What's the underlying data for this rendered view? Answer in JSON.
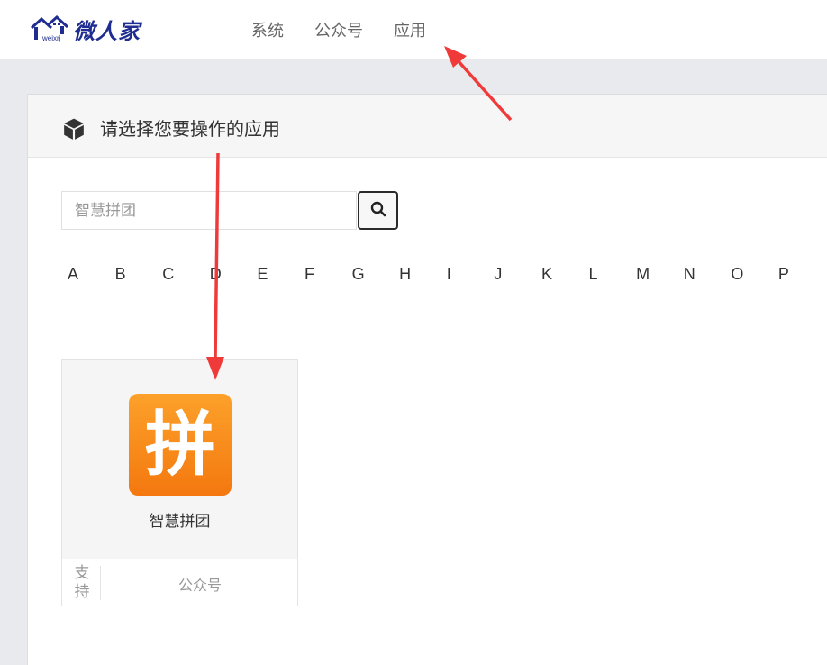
{
  "brand": {
    "name": "微人家",
    "sub": "weixrj"
  },
  "nav": {
    "items": [
      "系统",
      "公众号",
      "应用"
    ]
  },
  "panel": {
    "title": "请选择您要操作的应用"
  },
  "search": {
    "value": "",
    "placeholder": "智慧拼团"
  },
  "letters": [
    "A",
    "B",
    "C",
    "D",
    "E",
    "F",
    "G",
    "H",
    "I",
    "J",
    "K",
    "L",
    "M",
    "N",
    "O",
    "P"
  ],
  "app": {
    "icon_glyph": "拼",
    "name": "智慧拼团",
    "support_label": "支持",
    "support_type": "公众号"
  },
  "colors": {
    "brand": "#1e2d8f",
    "app_icon_top": "#fca12a",
    "app_icon_bottom": "#f4780f",
    "arrow": "#f03a3a"
  }
}
